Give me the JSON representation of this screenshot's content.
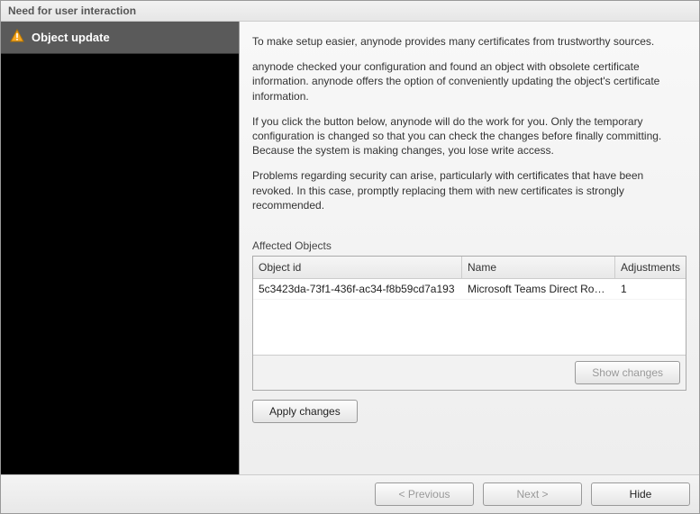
{
  "title": "Need for user interaction",
  "sidebar": {
    "item_label": "Object update"
  },
  "paragraphs": {
    "p1": "To make setup easier, anynode provides many certificates from trustworthy sources.",
    "p2": "anynode checked your configuration and found an object with obsolete certificate information. anynode offers the option of conveniently updating the object's certificate information.",
    "p3": "If you click the button below, anynode will do the work for you. Only the temporary configuration is changed so that you can check the changes before finally committing. Because the system is making changes, you lose write access.",
    "p4": "Problems regarding security can arise, particularly with certificates that have been revoked. In this case, promptly replacing them with new certificates is strongly recommended."
  },
  "affected": {
    "label": "Affected Objects",
    "columns": {
      "id": "Object id",
      "name": "Name",
      "adj": "Adjustments"
    },
    "rows": [
      {
        "id": "5c3423da-73f1-436f-ac34-f8b59cd7a193",
        "name": "Microsoft Teams Direct Routing",
        "adj": "1"
      }
    ],
    "show_changes": "Show changes"
  },
  "buttons": {
    "apply": "Apply changes",
    "previous": "< Previous",
    "next": "Next >",
    "hide": "Hide"
  }
}
